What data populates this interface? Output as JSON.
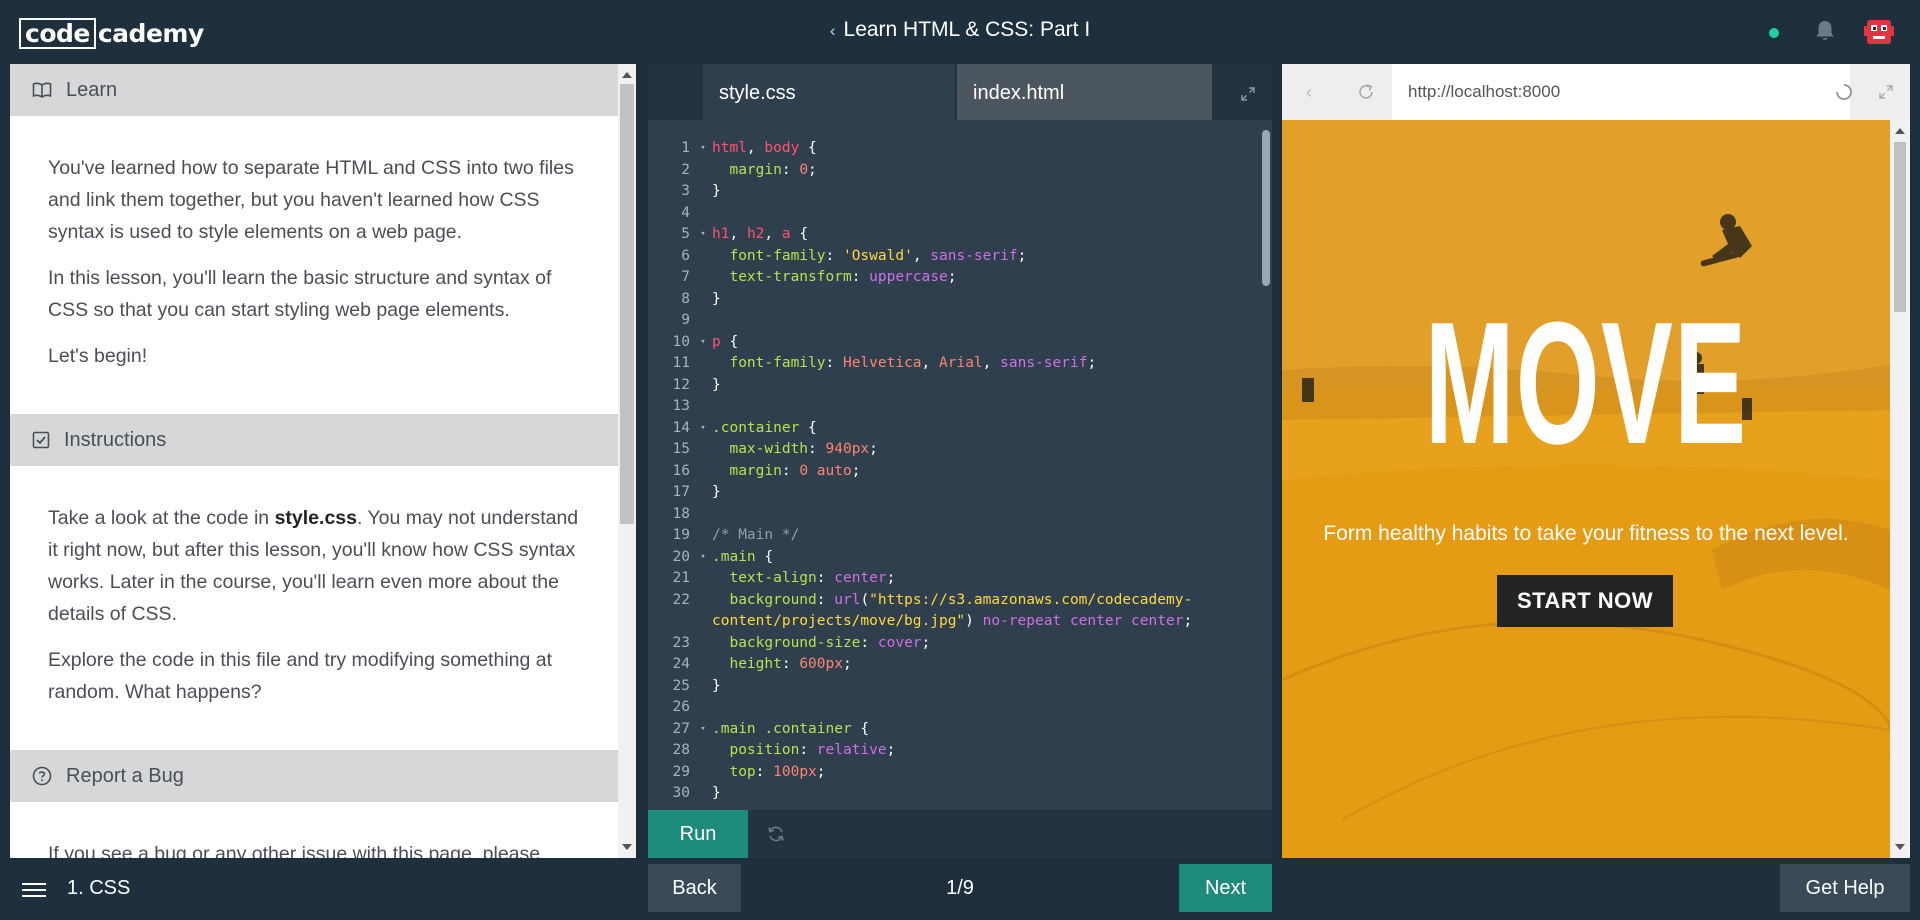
{
  "header": {
    "logo_boxed": "code",
    "logo_rest": "cademy",
    "back_chevron": "‹",
    "course_title": "Learn HTML & CSS: Part I"
  },
  "learn_panel": {
    "learn": {
      "title": "Learn",
      "paragraphs": [
        "You've learned how to separate HTML and CSS into two files and link them together, but you haven't learned how CSS syntax is used to style elements on a web page.",
        "In this lesson, you'll learn the basic structure and syntax of CSS so that you can start styling web page elements.",
        "Let's begin!"
      ]
    },
    "instructions": {
      "title": "Instructions",
      "p1_before": "Take a look at the code in ",
      "p1_bold": "style.css",
      "p1_after": ". You may not understand it right now, but after this lesson, you'll know how CSS syntax works. Later in the course, you'll learn even more about the details of CSS.",
      "p2": "Explore the code in this file and try modifying something at random. What happens?"
    },
    "report": {
      "title": "Report a Bug",
      "text": "If you see a bug or any other issue with this page, please"
    }
  },
  "editor": {
    "tabs": [
      "style.css",
      "index.html"
    ],
    "lines": [
      {
        "n": "1",
        "f": "▾",
        "t": [
          [
            "html",
            "sel"
          ],
          [
            ", ",
            ""
          ],
          [
            "body",
            "sel"
          ],
          [
            " {",
            ""
          ]
        ]
      },
      {
        "n": "2",
        "f": "",
        "t": [
          [
            "  margin",
            "prop"
          ],
          [
            ": ",
            ""
          ],
          [
            "0",
            "val"
          ],
          [
            ";",
            ""
          ]
        ]
      },
      {
        "n": "3",
        "f": "",
        "t": [
          [
            "}",
            ""
          ]
        ]
      },
      {
        "n": "4",
        "f": "",
        "t": []
      },
      {
        "n": "5",
        "f": "▾",
        "t": [
          [
            "h1",
            "sel"
          ],
          [
            ", ",
            ""
          ],
          [
            "h2",
            "sel"
          ],
          [
            ", ",
            ""
          ],
          [
            "a",
            "sel"
          ],
          [
            " {",
            ""
          ]
        ]
      },
      {
        "n": "6",
        "f": "",
        "t": [
          [
            "  font-family",
            "prop"
          ],
          [
            ": ",
            ""
          ],
          [
            "'Oswald'",
            "str"
          ],
          [
            ", ",
            ""
          ],
          [
            "sans-serif",
            "kw"
          ],
          [
            ";",
            ""
          ]
        ]
      },
      {
        "n": "7",
        "f": "",
        "t": [
          [
            "  text-transform",
            "prop"
          ],
          [
            ": ",
            ""
          ],
          [
            "uppercase",
            "kw"
          ],
          [
            ";",
            ""
          ]
        ]
      },
      {
        "n": "8",
        "f": "",
        "t": [
          [
            "}",
            ""
          ]
        ]
      },
      {
        "n": "9",
        "f": "",
        "t": []
      },
      {
        "n": "10",
        "f": "▾",
        "t": [
          [
            "p",
            "sel"
          ],
          [
            " {",
            ""
          ]
        ]
      },
      {
        "n": "11",
        "f": "",
        "t": [
          [
            "  font-family",
            "prop"
          ],
          [
            ": ",
            ""
          ],
          [
            "Helvetica",
            "val"
          ],
          [
            ", ",
            ""
          ],
          [
            "Arial",
            "val"
          ],
          [
            ", ",
            ""
          ],
          [
            "sans-serif",
            "kw"
          ],
          [
            ";",
            ""
          ]
        ]
      },
      {
        "n": "12",
        "f": "",
        "t": [
          [
            "}",
            ""
          ]
        ]
      },
      {
        "n": "13",
        "f": "",
        "t": []
      },
      {
        "n": "14",
        "f": "▾",
        "t": [
          [
            ".container",
            "cls"
          ],
          [
            " {",
            ""
          ]
        ]
      },
      {
        "n": "15",
        "f": "",
        "t": [
          [
            "  max-width",
            "prop"
          ],
          [
            ": ",
            ""
          ],
          [
            "940px",
            "val"
          ],
          [
            ";",
            ""
          ]
        ]
      },
      {
        "n": "16",
        "f": "",
        "t": [
          [
            "  margin",
            "prop"
          ],
          [
            ": ",
            ""
          ],
          [
            "0 auto",
            "val"
          ],
          [
            ";",
            ""
          ]
        ]
      },
      {
        "n": "17",
        "f": "",
        "t": [
          [
            "}",
            ""
          ]
        ]
      },
      {
        "n": "18",
        "f": "",
        "t": []
      },
      {
        "n": "19",
        "f": "",
        "t": [
          [
            "/* Main */",
            "com"
          ]
        ]
      },
      {
        "n": "20",
        "f": "▾",
        "t": [
          [
            ".main",
            "cls"
          ],
          [
            " {",
            ""
          ]
        ]
      },
      {
        "n": "21",
        "f": "",
        "t": [
          [
            "  text-align",
            "prop"
          ],
          [
            ": ",
            ""
          ],
          [
            "center",
            "kw"
          ],
          [
            ";",
            ""
          ]
        ]
      },
      {
        "n": "22",
        "f": "",
        "t": [
          [
            "  background",
            "prop"
          ],
          [
            ": ",
            ""
          ],
          [
            "url",
            "fn"
          ],
          [
            "(",
            ""
          ],
          [
            "\"https://s3.amazonaws.com/codecademy-",
            "str"
          ]
        ]
      },
      {
        "n": "",
        "f": "",
        "t": [
          [
            "content/projects/move/bg.jpg\"",
            "str"
          ],
          [
            ") ",
            ""
          ],
          [
            "no-repeat center center",
            "kw"
          ],
          [
            ";",
            ""
          ]
        ]
      },
      {
        "n": "23",
        "f": "",
        "t": [
          [
            "  background-size",
            "prop"
          ],
          [
            ": ",
            ""
          ],
          [
            "cover",
            "kw"
          ],
          [
            ";",
            ""
          ]
        ]
      },
      {
        "n": "24",
        "f": "",
        "t": [
          [
            "  height",
            "prop"
          ],
          [
            ": ",
            ""
          ],
          [
            "600px",
            "val"
          ],
          [
            ";",
            ""
          ]
        ]
      },
      {
        "n": "25",
        "f": "",
        "t": [
          [
            "}",
            ""
          ]
        ]
      },
      {
        "n": "26",
        "f": "",
        "t": []
      },
      {
        "n": "27",
        "f": "▾",
        "t": [
          [
            ".main .container",
            "cls"
          ],
          [
            " {",
            ""
          ]
        ]
      },
      {
        "n": "28",
        "f": "",
        "t": [
          [
            "  position",
            "prop"
          ],
          [
            ": ",
            ""
          ],
          [
            "relative",
            "kw"
          ],
          [
            ";",
            ""
          ]
        ]
      },
      {
        "n": "29",
        "f": "",
        "t": [
          [
            "  top",
            "prop"
          ],
          [
            ": ",
            ""
          ],
          [
            "100px",
            "val"
          ],
          [
            ";",
            ""
          ]
        ]
      },
      {
        "n": "30",
        "f": "",
        "t": [
          [
            "}",
            ""
          ]
        ]
      }
    ],
    "run_label": "Run"
  },
  "browser": {
    "url": "http://localhost:8000",
    "back_glyph": "‹",
    "hero_title": "MOVE",
    "hero_subtitle": "Form healthy habits to take your fitness to the next level.",
    "cta": "START NOW",
    "hero_color": "#e8a11d"
  },
  "footer": {
    "lesson": "1. CSS",
    "back": "Back",
    "progress": "1/9",
    "next": "Next",
    "help": "Get Help"
  }
}
